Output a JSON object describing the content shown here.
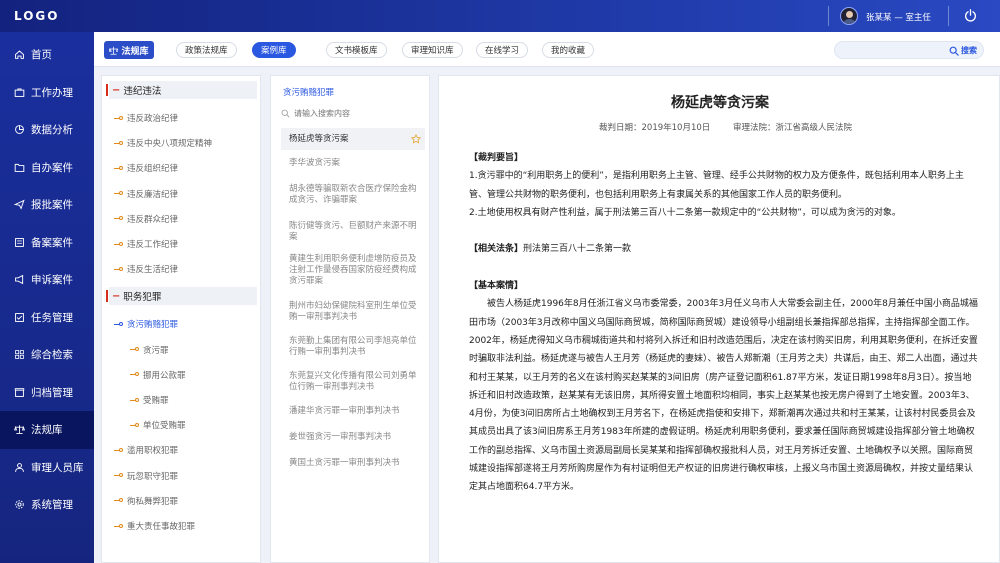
{
  "header": {
    "logo": "LOGO",
    "user": "张某某 — 室主任"
  },
  "sidebar": {
    "items": [
      {
        "label": "首页",
        "icon": "home-icon"
      },
      {
        "label": "工作办理",
        "icon": "briefcase-icon"
      },
      {
        "label": "数据分析",
        "icon": "chart-icon"
      },
      {
        "label": "自办案件",
        "icon": "folder-icon"
      },
      {
        "label": "报批案件",
        "icon": "send-icon"
      },
      {
        "label": "备案案件",
        "icon": "archive-icon"
      },
      {
        "label": "申诉案件",
        "icon": "megaphone-icon"
      },
      {
        "label": "任务管理",
        "icon": "task-icon"
      },
      {
        "label": "综合检索",
        "icon": "grid-icon"
      },
      {
        "label": "归档管理",
        "icon": "box-icon"
      },
      {
        "label": "法规库",
        "icon": "scale-icon"
      },
      {
        "label": "审理人员库",
        "icon": "user-icon"
      },
      {
        "label": "系统管理",
        "icon": "gear-icon"
      }
    ],
    "active_index": 10
  },
  "subbar": {
    "title": "法规库",
    "tabs": [
      "政策法规库",
      "案例库",
      "文书模板库",
      "审理知识库",
      "在线学习",
      "我的收藏"
    ],
    "active_tab": 1,
    "search_placeholder": "",
    "search_button": "搜索"
  },
  "tree": {
    "categories": [
      {
        "label": "违纪违法",
        "children": [
          "违反政治纪律",
          "违反中央八项规定精神",
          "违反组织纪律",
          "违反廉洁纪律",
          "违反群众纪律",
          "违反工作纪律",
          "违反生活纪律"
        ]
      },
      {
        "label": "职务犯罪",
        "children": [
          "贪污贿赂犯罪",
          "贪污罪",
          "挪用公款罪",
          "受贿罪",
          "单位受贿罪",
          "滥用职权犯罪",
          "玩忽职守犯罪",
          "徇私舞弊犯罪",
          "重大责任事故犯罪"
        ]
      }
    ]
  },
  "case_list": {
    "heading": "贪污贿赂犯罪",
    "search_placeholder": "请输入搜索内容",
    "items": [
      "杨延虎等贪污案",
      "李华波贪污案",
      "胡永德等骗取新农合医疗保险金构成贪污、诈骗罪案",
      "陈衍健等贪污、巨额财产来源不明案",
      "黄建生利用职务便利虚增防疫员及注射工作量侵吞国家防疫经费构成贪污罪案",
      "荆州市妇幼保健院科室刑生单位受贿一审刑事判决书",
      "东莞勤上集团有限公司李旭亮单位行贿一审刑事判决书",
      "东莞复兴文化传播有限公司刘勇单位行贿一审刑事判决书",
      "潘建华贪污罪一审刑事判决书",
      "姜世强贪污一审刑事判决书",
      "黄国土贪污罪一审刑事判决书"
    ]
  },
  "document": {
    "title": "杨延虎等贪污案",
    "date_label": "裁判日期：2019年10月10日",
    "court_label": "审理法院：浙江省高级人民法院",
    "section1_title": "【裁判要旨】",
    "section1_p1": "1.贪污罪中的“利用职务上的便利”，是指利用职务上主管、管理、经手公共财物的权力及方便条件，既包括利用本人职务上主管、管理公共财物的职务便利，也包括利用职务上有隶属关系的其他国家工作人员的职务便利。",
    "section1_p2": "2.土地使用权具有财产性利益，属于刑法第三百八十二条第一款规定中的“公共财物”，可以成为贪污的对象。",
    "section2_title": "【相关法条】",
    "section2_text": "刑法第三百八十二条第一款",
    "section3_title": "【基本案情】",
    "section3_text": "被告人杨延虎1996年8月任浙江省义乌市委常委，2003年3月任义乌市人大常委会副主任，2000年8月兼任中国小商品城福田市场（2003年3月改称中国义乌国际商贸城，简称国际商贸城）建设领导小组副组长兼指挥部总指挥，主持指挥部全面工作。2002年，杨延虎得知义乌市稠城街道共和村将列入拆迁和旧村改造范围后，决定在该村购买旧房，利用其职务便利，在拆迁安置时骗取非法利益。杨延虎遂与被告人王月芳（杨延虎的妻妹）、被告人郑新潮（王月芳之夫）共谋后，由王、郑二人出面，通过共和村王某某，以王月芳的名义在该村购买赵某某的3间旧房（房产证登记面积61.87平方米，发证日期1998年8月3日）。按当地拆迁和旧村改造政策，赵某某有无该旧房，其所得安置土地面积均相同，事实上赵某某也按无房户得到了土地安置。2003年3、4月份，为使3间旧房所占土地确权到王月芳名下，在杨延虎指使和安排下，郑新潮再次通过共和村王某某，让该村村民委员会及其成员出具了该3间旧房系王月芳1983年所建的虚假证明。杨延虎利用职务便利，要求兼任国际商贸城建设指挥部分管土地确权工作的副总指挥、义乌市国土资源局副局长吴某某和指挥部确权报批科人员，对王月芳拆迁安置、土地确权予以关照。国际商贸城建设指挥部遂将王月芳所购房屋作为有村证明但无产权证的旧房进行确权审核，上报义乌市国土资源局确权，并按丈量结果认定其占地面积64.7平方米。"
  }
}
